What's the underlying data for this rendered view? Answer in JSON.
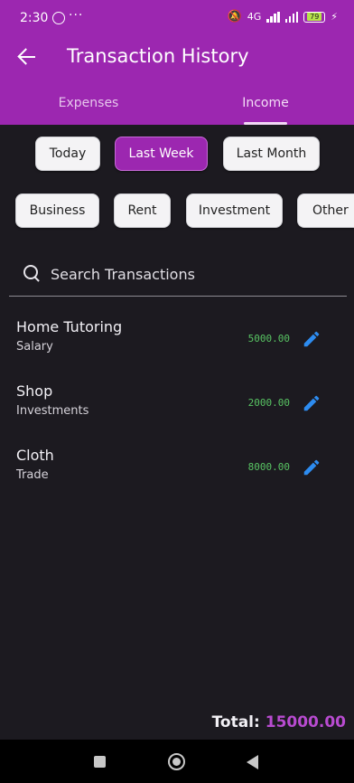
{
  "status": {
    "time": "2:30",
    "dots": "···",
    "network": "4G",
    "battery": "79"
  },
  "appbar": {
    "title": "Transaction History"
  },
  "tabs": [
    {
      "label": "Expenses"
    },
    {
      "label": "Income"
    }
  ],
  "period_filters": [
    {
      "label": "Today",
      "selected": false
    },
    {
      "label": "Last Week",
      "selected": true
    },
    {
      "label": "Last Month",
      "selected": false
    }
  ],
  "category_filters": [
    {
      "label": "Business"
    },
    {
      "label": "Rent"
    },
    {
      "label": "Investment"
    },
    {
      "label": "Other"
    }
  ],
  "search": {
    "placeholder": "Search Transactions"
  },
  "transactions": [
    {
      "name": "Home Tutoring",
      "category": "Salary",
      "amount": "5000.00"
    },
    {
      "name": "Shop",
      "category": "Investments",
      "amount": "2000.00"
    },
    {
      "name": "Cloth",
      "category": "Trade",
      "amount": "8000.00"
    }
  ],
  "total": {
    "label": "Total:",
    "value": "15000.00"
  },
  "colors": {
    "accent": "#9c27b0",
    "income_amount": "#58c463",
    "edit_icon": "#2d8cf0",
    "total_value": "#b84bd0",
    "background": "#1c1a20"
  }
}
